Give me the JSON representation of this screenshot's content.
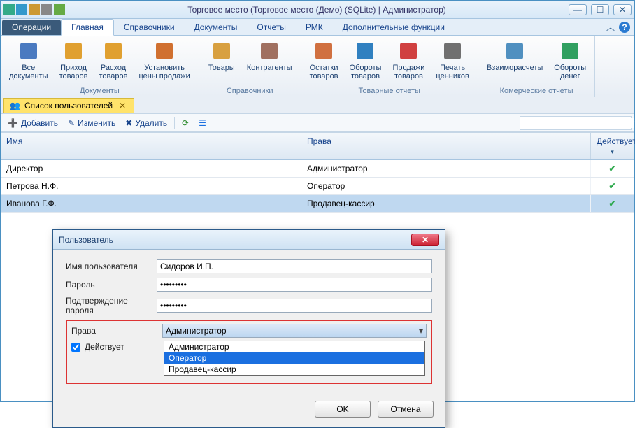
{
  "window": {
    "title": "Торговое место (Торговое место (Демо) (SQLite) | Администратор)"
  },
  "menu": {
    "operations": "Операции",
    "tabs": [
      "Главная",
      "Справочники",
      "Документы",
      "Отчеты",
      "РМК",
      "Дополнительные функции"
    ],
    "active_index": 0
  },
  "ribbon": {
    "groups": [
      {
        "name": "Документы",
        "items": [
          {
            "id": "all-docs",
            "label": "Все\nдокументы"
          },
          {
            "id": "income",
            "label": "Приход\nтоваров"
          },
          {
            "id": "outcome",
            "label": "Расход\nтоваров"
          },
          {
            "id": "set-prices",
            "label": "Установить\nцены продажи"
          }
        ]
      },
      {
        "name": "Справочники",
        "items": [
          {
            "id": "goods",
            "label": "Товары"
          },
          {
            "id": "contragents",
            "label": "Контрагенты"
          }
        ]
      },
      {
        "name": "Товарные отчеты",
        "items": [
          {
            "id": "rests",
            "label": "Остатки\nтоваров"
          },
          {
            "id": "turnover",
            "label": "Обороты\nтоваров"
          },
          {
            "id": "sales",
            "label": "Продажи\nтоваров"
          },
          {
            "id": "price-print",
            "label": "Печать\nценников"
          }
        ]
      },
      {
        "name": "Комерческие отчеты",
        "items": [
          {
            "id": "settlements",
            "label": "Взаиморасчеты"
          },
          {
            "id": "money-turn",
            "label": "Обороты\nденег"
          }
        ]
      }
    ]
  },
  "doctab": {
    "title": "Список пользователей"
  },
  "toolbar": {
    "add": "Добавить",
    "edit": "Изменить",
    "delete": "Удалить",
    "search_placeholder": ""
  },
  "grid": {
    "columns": {
      "name": "Имя",
      "rights": "Права",
      "active": "Действует"
    },
    "rows": [
      {
        "name": "Директор",
        "rights": "Администратор",
        "active": true,
        "selected": false
      },
      {
        "name": "Петрова Н.Ф.",
        "rights": "Оператор",
        "active": true,
        "selected": false
      },
      {
        "name": "Иванова Г.Ф.",
        "rights": "Продавец-кассир",
        "active": true,
        "selected": true
      }
    ]
  },
  "dialog": {
    "title": "Пользователь",
    "labels": {
      "username": "Имя пользователя",
      "password": "Пароль",
      "confirm": "Подтверждение пароля",
      "rights": "Права",
      "active": "Действует"
    },
    "values": {
      "username": "Сидоров И.П.",
      "password": "•••••••••",
      "confirm": "•••••••••",
      "rights": "Администратор",
      "active": true
    },
    "rights_options": [
      "Администратор",
      "Оператор",
      "Продавец-кассир"
    ],
    "rights_highlight_index": 1,
    "buttons": {
      "ok": "OK",
      "cancel": "Отмена"
    }
  }
}
